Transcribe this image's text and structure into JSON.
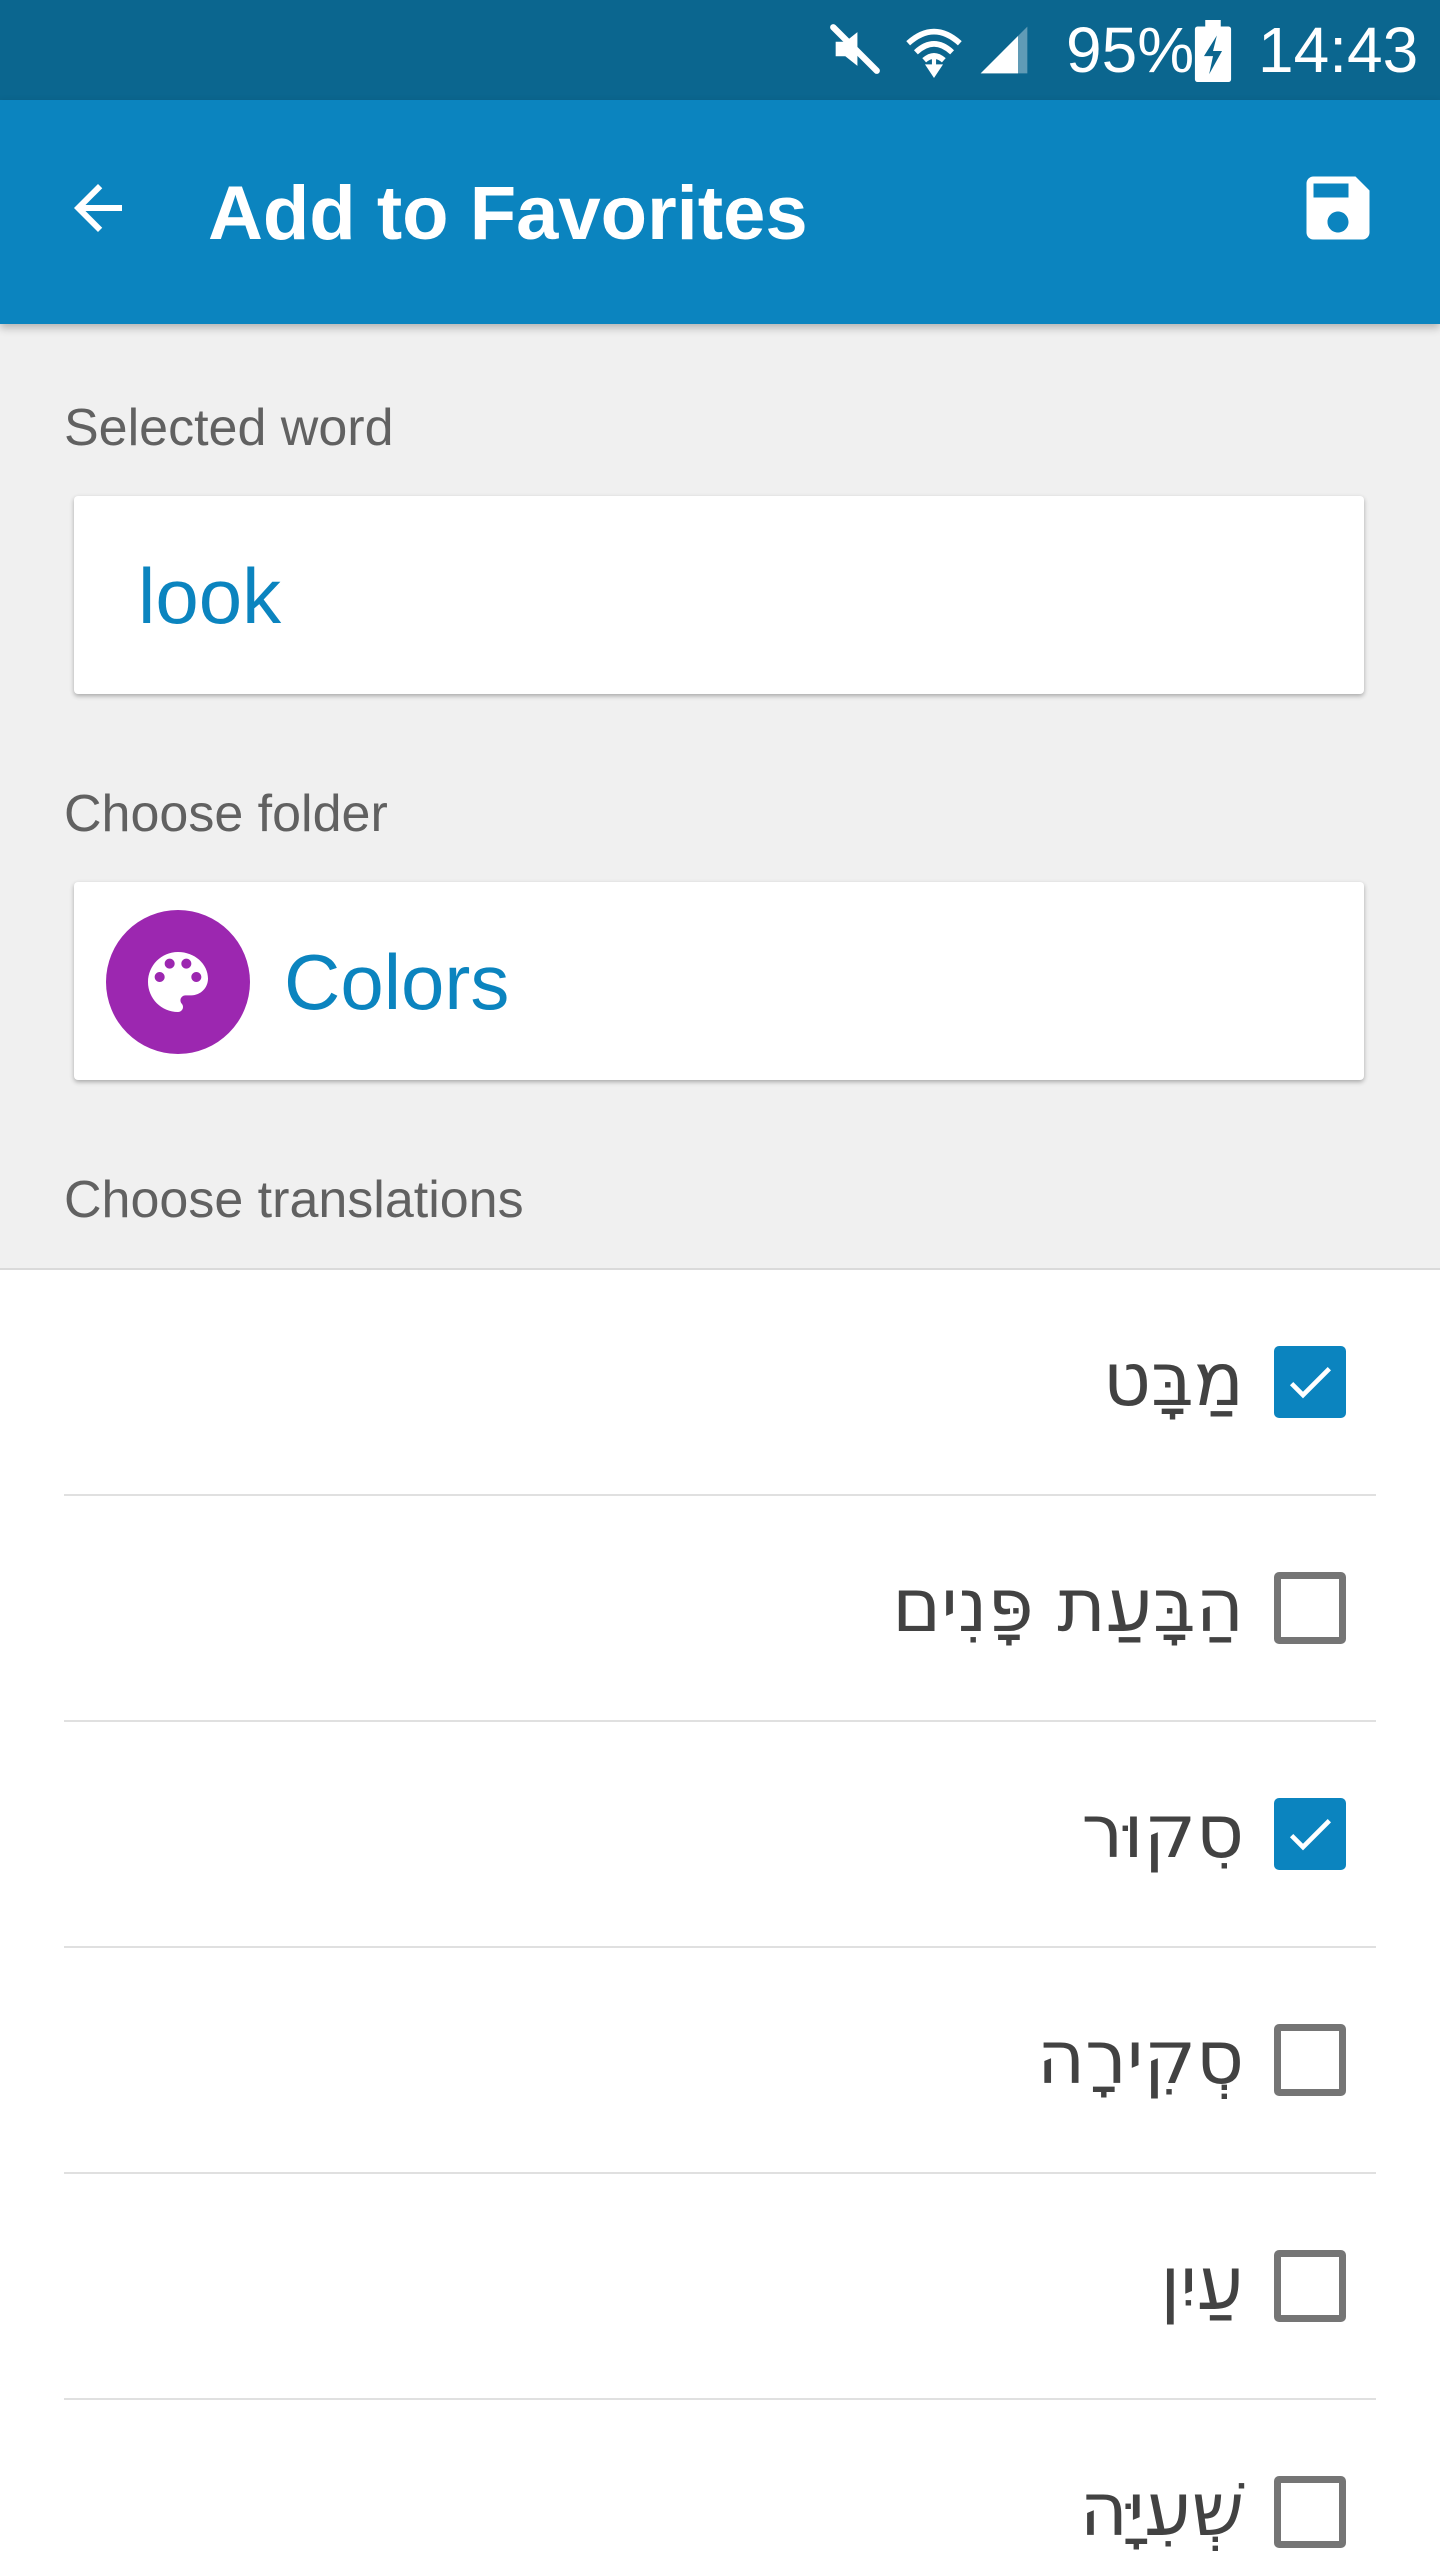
{
  "status_bar": {
    "battery": "95%",
    "time": "14:43",
    "icons": [
      "mute-icon",
      "wifi-icon",
      "signal-icon",
      "battery-charging-icon"
    ]
  },
  "app_bar": {
    "title": "Add to Favorites",
    "back_icon": "arrow-back-icon",
    "save_icon": "save-icon",
    "background": "#0b84bf"
  },
  "form": {
    "selected_word_label": "Selected word",
    "selected_word_value": "look",
    "folder_label": "Choose folder",
    "folder": {
      "name": "Colors",
      "icon": "palette-icon",
      "color": "#9c27b0"
    },
    "translations_label": "Choose translations"
  },
  "translations": [
    {
      "text": "מַבָּט",
      "checked": true
    },
    {
      "text": "הַבָּעַת פָּנִים",
      "checked": false
    },
    {
      "text": "סִקוּר",
      "checked": true
    },
    {
      "text": "סְקִירָה",
      "checked": false
    },
    {
      "text": "עַיִן",
      "checked": false
    },
    {
      "text": "שְׁעִיָּה",
      "checked": false
    }
  ],
  "colors": {
    "accent": "#0b84bf",
    "status_bar": "#0b668f",
    "checkbox_unchecked": "#757575"
  }
}
